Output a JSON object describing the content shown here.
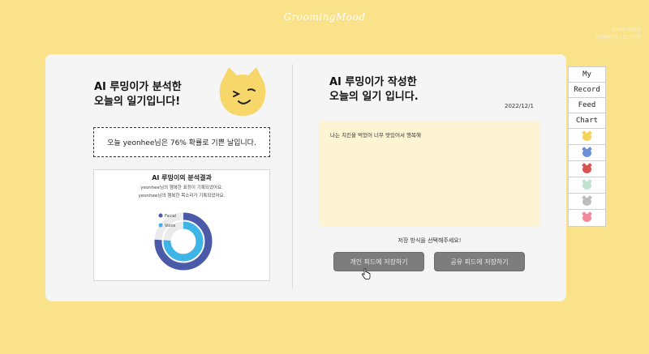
{
  "app": {
    "brand": "GroomingMood"
  },
  "user": {
    "line1": "Guest 회원님",
    "line2": "마이페이지 | 로그아웃"
  },
  "left": {
    "title_line1": "AI 루밍이가 분석한",
    "title_line2": "오늘의 일기입니다!",
    "result_text": "오늘 yeonhee님은 76% 확률로 기쁜 날입니다.",
    "analysis": {
      "title": "AI 루밍이의 분석결과",
      "line1": "yeonhee님의 행복한 표정이 기록되었어요.",
      "line2": "yeonhee님의 행복한 목소리가 기록되었어요.",
      "legend": [
        {
          "label": "Facial",
          "color": "#4a5aa8"
        },
        {
          "label": "Voice",
          "color": "#3fb4e6"
        }
      ]
    }
  },
  "chart_data": {
    "type": "pie",
    "series": [
      {
        "name": "Facial",
        "values": [
          76
        ]
      },
      {
        "name": "Voice",
        "values": [
          76
        ]
      }
    ]
  },
  "right": {
    "title_line1": "AI 루밍이가 작성한",
    "title_line2": "오늘의 일기 입니다.",
    "date": "2022/12/1",
    "diary_text": "나는 치킨을 먹었어 너무 맛있어서 행복해",
    "save_prompt": "저장 방식을 선택해주세요!",
    "btn_personal": "개인 피드에 저장하기",
    "btn_shared": "공유 피드에 저장하기"
  },
  "nav": {
    "items": [
      "My",
      "Record",
      "Feed",
      "Chart"
    ],
    "icons": [
      {
        "name": "yellow-cat-icon",
        "color": "#f3d55b"
      },
      {
        "name": "blue-cat-icon",
        "color": "#6b8fd6"
      },
      {
        "name": "red-cat-icon",
        "color": "#d9534f"
      },
      {
        "name": "green-cat-icon",
        "color": "#bfe3cf"
      },
      {
        "name": "gray-cat-icon",
        "color": "#bdbdbd"
      },
      {
        "name": "pink-cat-icon",
        "color": "#f08a9a"
      }
    ]
  }
}
